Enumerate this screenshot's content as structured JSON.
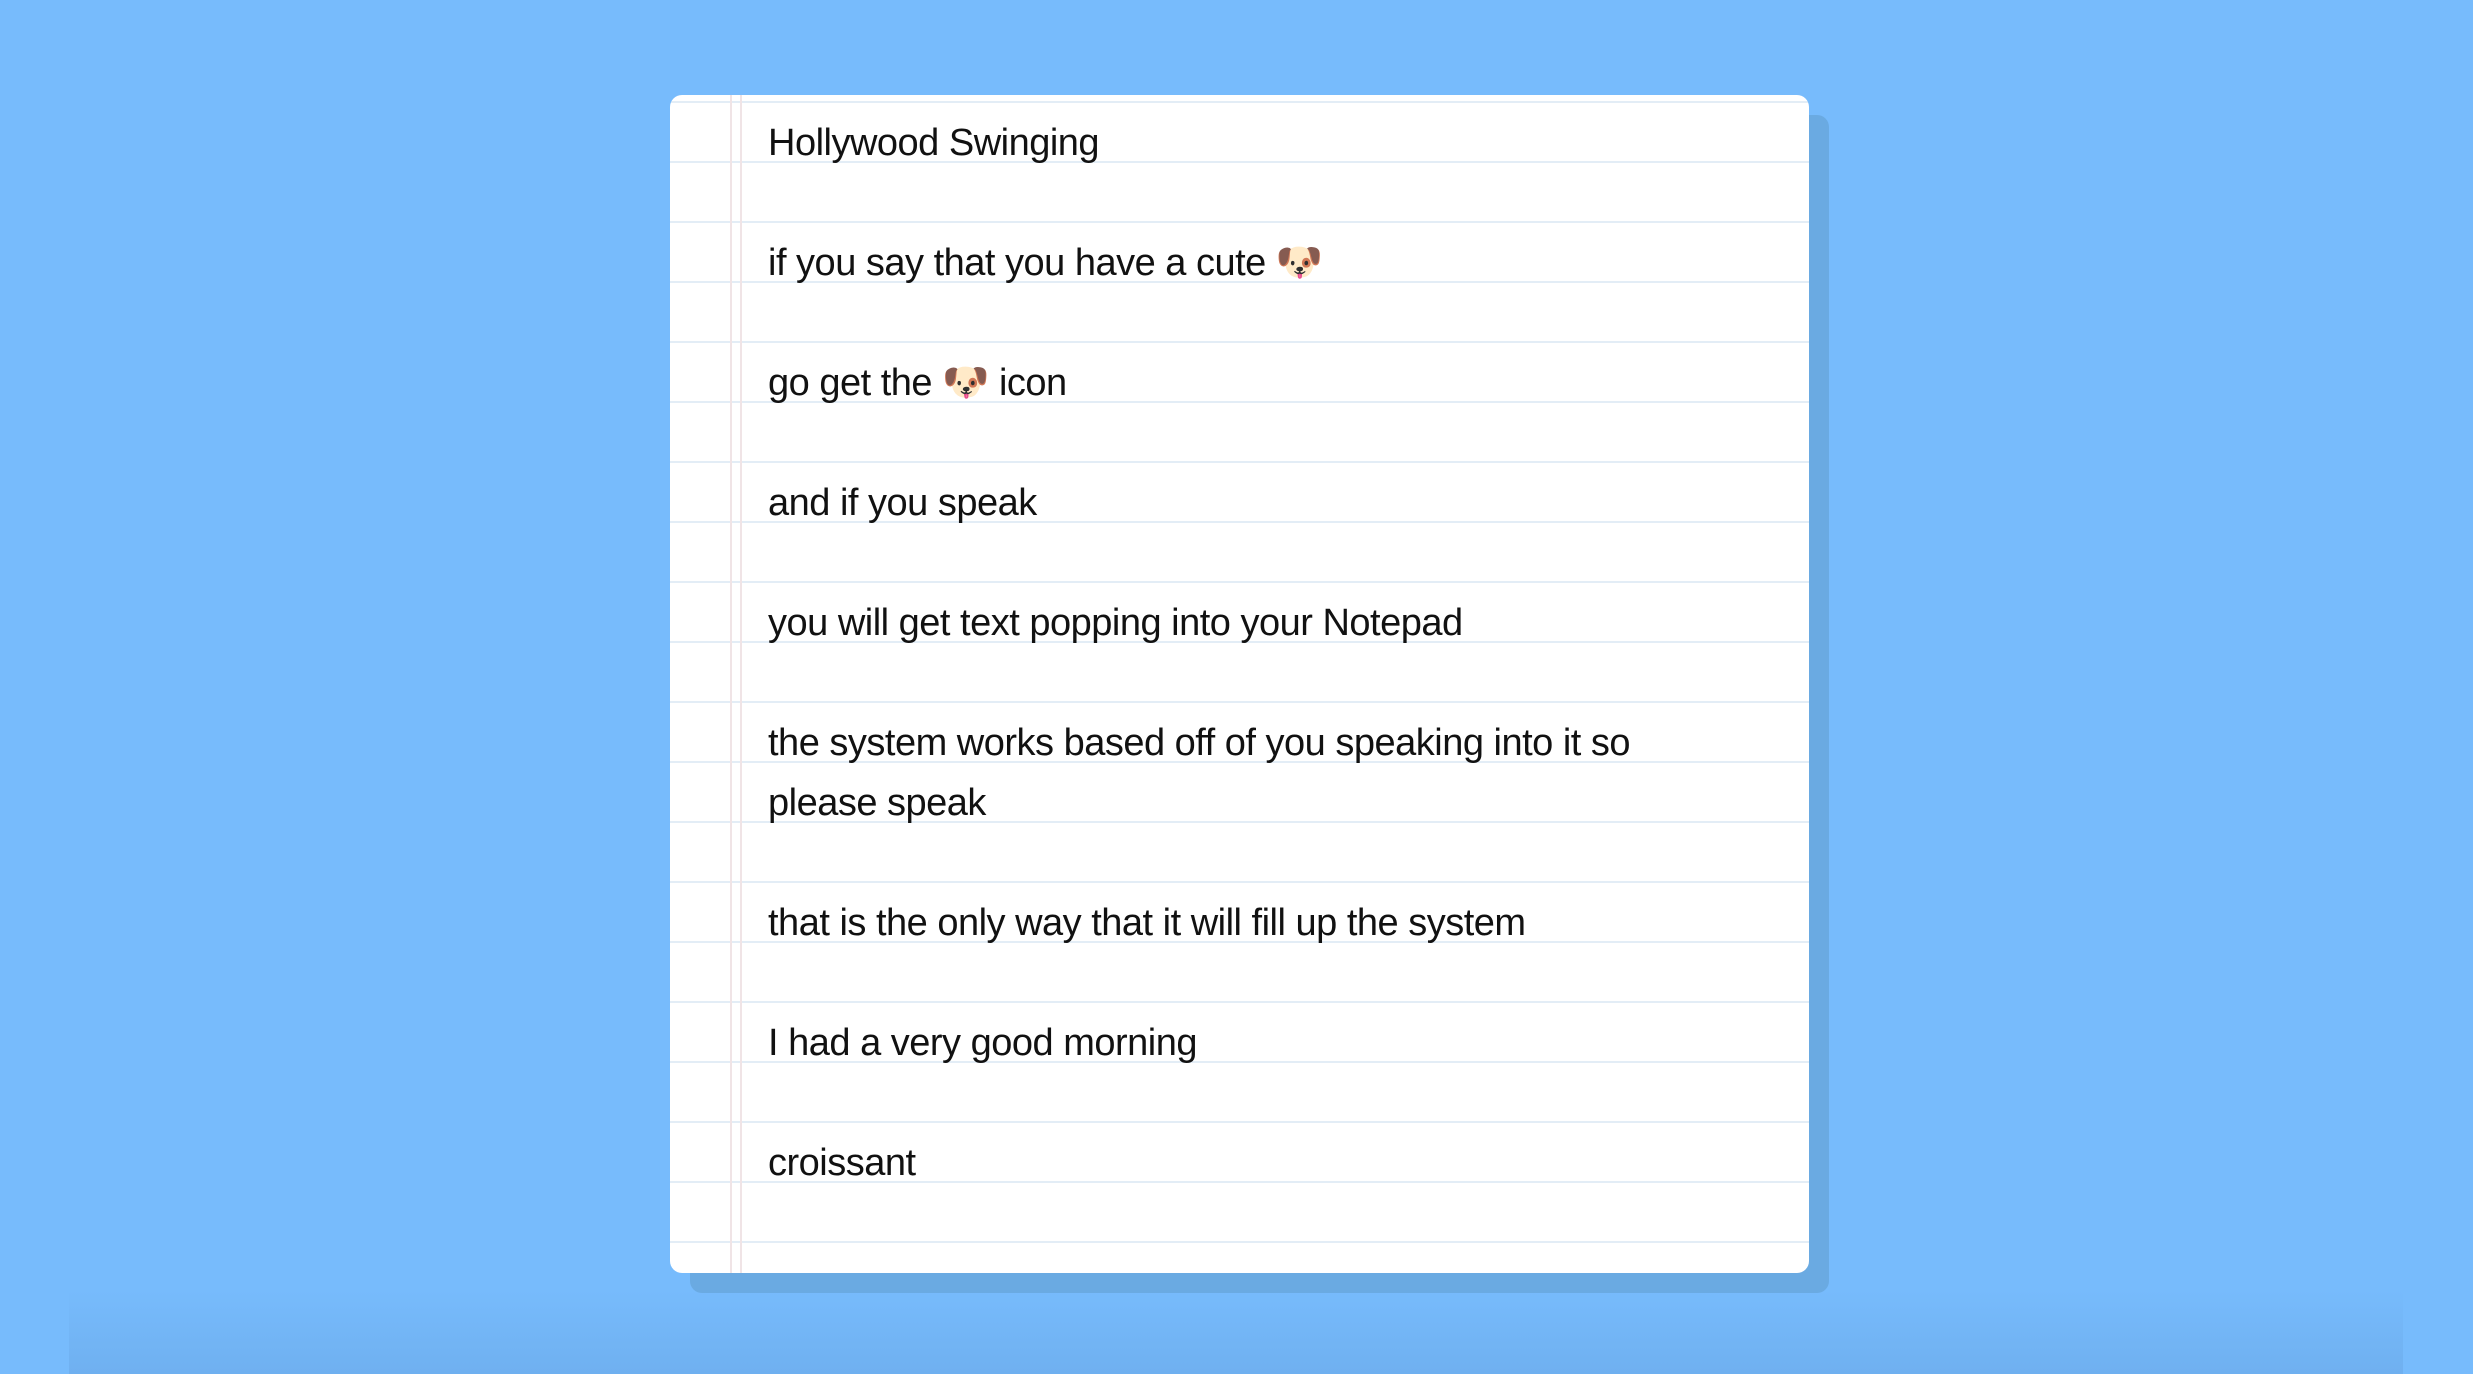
{
  "notepad": {
    "notes": [
      "Hollywood Swinging",
      "if you say that you have a cute 🐶",
      "go get the 🐶 icon",
      "and if you speak",
      "you will get text popping into your Notepad",
      "the system works based off of you speaking into it so please speak",
      "that is the only way that it will fill up the system",
      "I had a very good morning",
      "croissant"
    ]
  },
  "colors": {
    "background": "#77bbfc",
    "paper": "#ffffff",
    "shadow": "#6aaae2",
    "rule": "#e3edf6"
  }
}
